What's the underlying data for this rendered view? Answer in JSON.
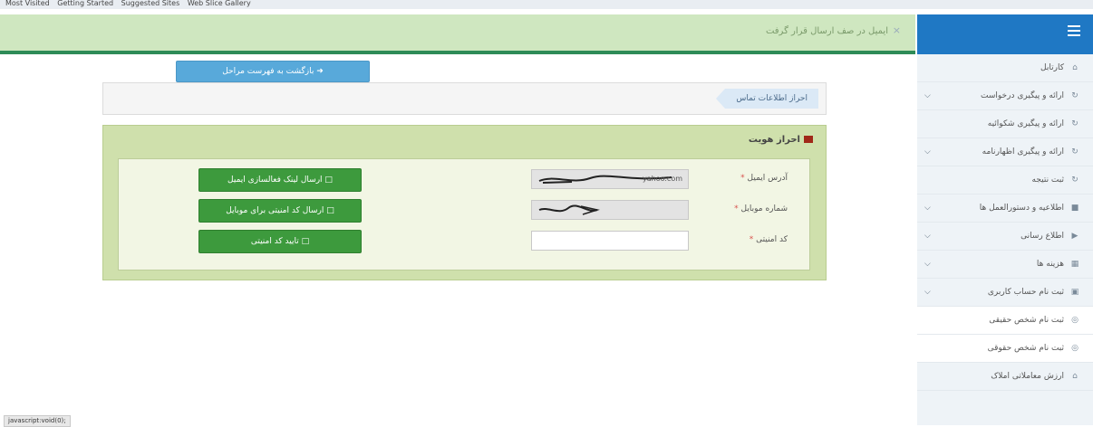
{
  "bookmarks": [
    "Most Visited",
    "Getting Started",
    "Suggested Sites",
    "Web Slice Gallery"
  ],
  "alert": {
    "message": "ایمیل در صف ارسال قرار گرفت",
    "close": "×"
  },
  "sidebar": {
    "items": [
      {
        "label": "کارتابل",
        "icon": "home-icon",
        "chevron": false,
        "sub": false
      },
      {
        "label": "ارائه و پیگیری درخواست",
        "icon": "refresh-icon",
        "chevron": true,
        "sub": false
      },
      {
        "label": "ارائه و پیگیری شکوائیه",
        "icon": "refresh-icon",
        "chevron": false,
        "sub": false
      },
      {
        "label": "ارائه و پیگیری اظهارنامه",
        "icon": "refresh-icon",
        "chevron": true,
        "sub": false
      },
      {
        "label": "ثبت نتیجه",
        "icon": "refresh-icon",
        "chevron": false,
        "sub": false
      },
      {
        "label": "اطلاعیه و دستورالعمل ها",
        "icon": "file-icon",
        "chevron": true,
        "sub": false
      },
      {
        "label": "اطلاع رسانی",
        "icon": "megaphone-icon",
        "chevron": true,
        "sub": false
      },
      {
        "label": "هزینه ها",
        "icon": "calculator-icon",
        "chevron": true,
        "sub": false
      },
      {
        "label": "ثبت نام حساب کاربری",
        "icon": "edit-icon",
        "chevron": true,
        "sub": false
      },
      {
        "label": "ثبت نام شخص حقیقی",
        "icon": "eye-icon",
        "chevron": false,
        "sub": true
      },
      {
        "label": "ثبت نام شخص حقوقی",
        "icon": "eye-icon",
        "chevron": false,
        "sub": true
      },
      {
        "label": "ارزش معاملاتی املاک",
        "icon": "home-icon",
        "chevron": false,
        "sub": false
      }
    ]
  },
  "back_button": {
    "label": "بازگشت به فهرست مراحل"
  },
  "breadcrumb": {
    "label": "احراز اطلاعات تماس"
  },
  "panel": {
    "title": "احراز هویت",
    "rows": [
      {
        "label": "آدرس ایمیل",
        "required": "*",
        "value": "yahoo.com",
        "readonly": true,
        "button": "ارسال لینک فعالسازی ایمیل"
      },
      {
        "label": "شماره موبایل",
        "required": "*",
        "value": "",
        "readonly": true,
        "button": "ارسال کد امنیتی برای موبایل"
      },
      {
        "label": "کد امنیتی",
        "required": "*",
        "value": "",
        "readonly": false,
        "button": "تایید کد امنیتی"
      }
    ]
  },
  "status_bar": {
    "text": "javascript:void(0);"
  }
}
